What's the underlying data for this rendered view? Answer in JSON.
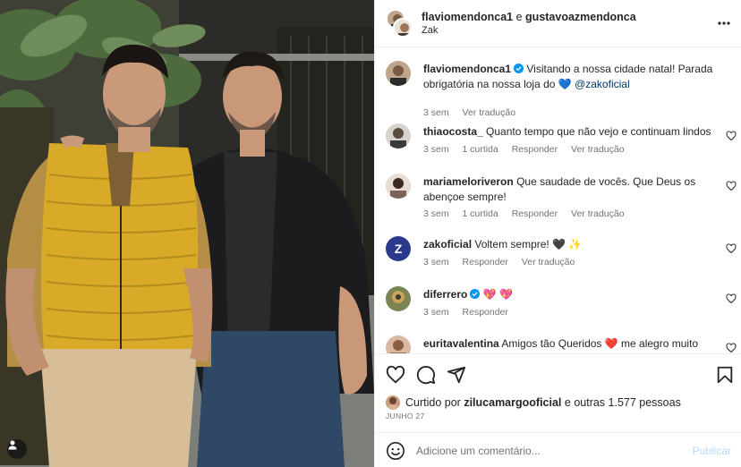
{
  "post": {
    "photo": "Two men posing in front of a plant-filled storefront"
  },
  "header": {
    "owner": "flaviomendonca1",
    "connector": "e",
    "collaborator": "gustavoazmendonca",
    "subtitle": "Zak",
    "more_icon": "more-horizontal-icon"
  },
  "caption": {
    "username": "flaviomendonca1",
    "text": "Visitando a nossa cidade natal! Parada obrigatória na nossa loja do",
    "mention": "@zakoficial",
    "time": "3 sem",
    "translate": "Ver tradução"
  },
  "comments": [
    {
      "username": "thiaocosta_",
      "text": "Quanto tempo que não vejo e continuam lindos",
      "time": "3 sem",
      "likes": "1 curtida",
      "reply": "Responder",
      "translate": "Ver tradução"
    },
    {
      "username": "mariameloriveron",
      "text": "Que saudade de vocês. Que Deus os abençoe sempre!",
      "time": "3 sem",
      "likes": "1 curtida",
      "reply": "Responder",
      "translate": "Ver tradução"
    },
    {
      "username": "zakoficial",
      "text": "Voltem sempre! 🖤 ✨",
      "time": "3 sem",
      "reply": "Responder",
      "translate": "Ver tradução"
    },
    {
      "username": "diferrero",
      "text": "💖 💖",
      "time": "3 sem",
      "reply": "Responder"
    },
    {
      "username": "euritavalentina",
      "text": "Amigos tão Queridos ❤️ me alegro muito"
    }
  ],
  "likes": {
    "prefix": "Curtido por",
    "by": "zilucamargooficial",
    "connector": "e",
    "others": "outras 1.577 pessoas"
  },
  "date": "JUNHO 27",
  "add_comment": {
    "placeholder": "Adicione um comentário...",
    "post_label": "Publicar"
  },
  "colors": {
    "text": "#262626",
    "muted": "#737373",
    "link": "#00376b",
    "verified": "#0095f6",
    "post_disabled": "#b3dbff",
    "vest": "#d9a928"
  }
}
